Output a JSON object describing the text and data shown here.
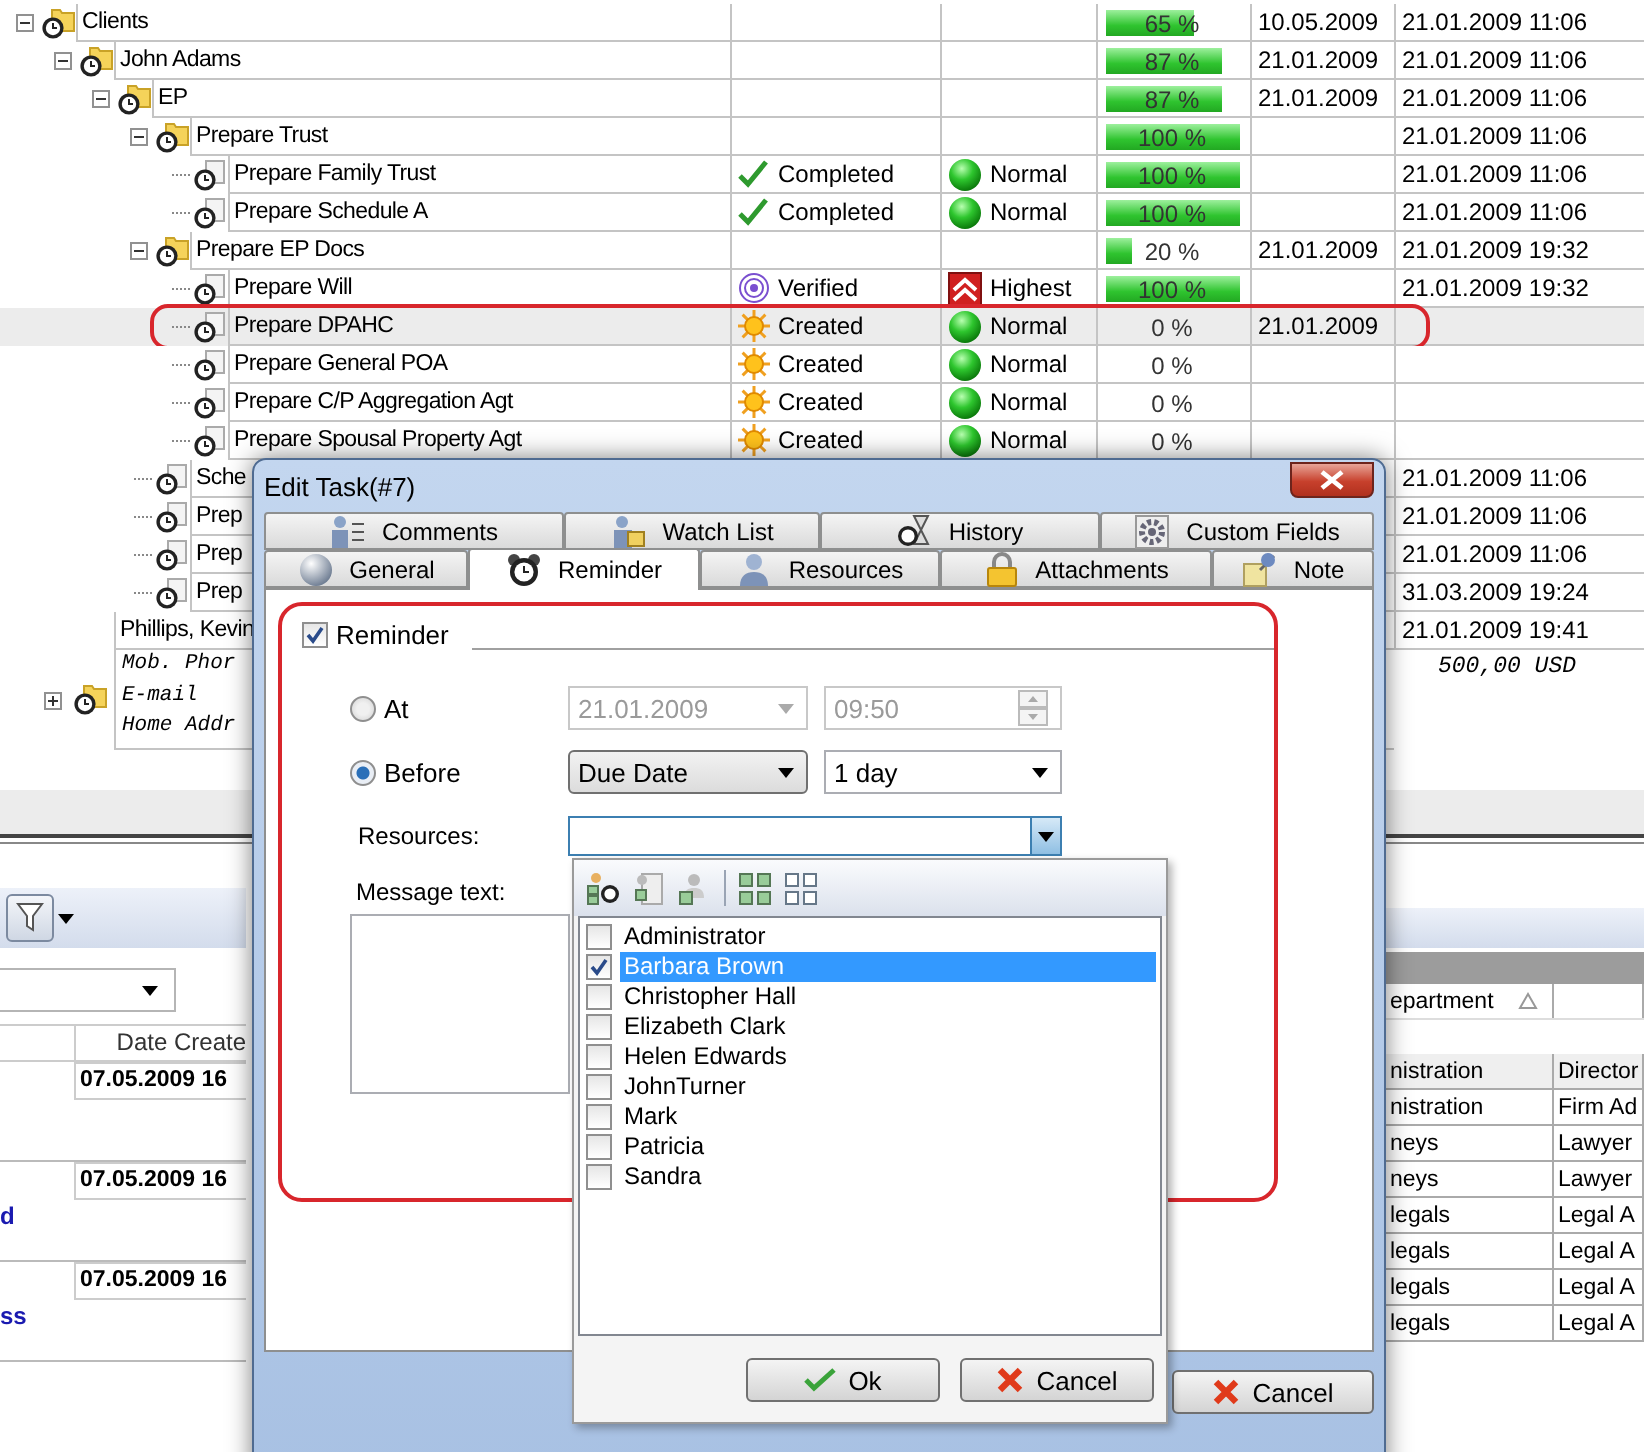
{
  "tree": [
    {
      "kind": "task",
      "name": "Clients",
      "expanded": true,
      "selected": false,
      "progress": {
        "level": 0.65,
        "text": "65 %"
      },
      "due": "10.05.2009",
      "created": "21.01.2009 11:06",
      "children": [
        {
          "kind": "task",
          "name": "John Adams",
          "expanded": true,
          "selected": false,
          "progress": {
            "level": 0.87,
            "text": "87 %"
          },
          "due": "21.01.2009",
          "created": "21.01.2009 11:06",
          "children": [
            {
              "kind": "task",
              "name": "EP",
              "expanded": true,
              "selected": false,
              "progress": {
                "level": 0.87,
                "text": "87 %"
              },
              "due": "21.01.2009",
              "created": "21.01.2009 11:06",
              "children": [
                {
                  "kind": "task",
                  "name": "Prepare Trust",
                  "expanded": true,
                  "selected": false,
                  "progress": {
                    "level": 1,
                    "text": "100 %"
                  },
                  "created": "21.01.2009 11:06",
                  "children": [
                    {
                      "kind": "task",
                      "name": "Prepare Family Trust",
                      "selected": false,
                      "status": {
                        "kind": "completed",
                        "text": "Completed"
                      },
                      "priority": {
                        "kind": "normal",
                        "text": "Normal"
                      },
                      "progress": {
                        "level": 1,
                        "text": "100 %"
                      },
                      "created": "21.01.2009 11:06"
                    },
                    {
                      "kind": "task",
                      "name": "Prepare Schedule A",
                      "selected": false,
                      "status": {
                        "kind": "completed",
                        "text": "Completed"
                      },
                      "priority": {
                        "kind": "normal",
                        "text": "Normal"
                      },
                      "progress": {
                        "level": 1,
                        "text": "100 %"
                      },
                      "created": "21.01.2009 11:06"
                    }
                  ]
                },
                {
                  "kind": "task",
                  "name": "Prepare EP Docs",
                  "expanded": true,
                  "selected": false,
                  "progress": {
                    "level": 0.2,
                    "text": "20 %"
                  },
                  "due": "21.01.2009",
                  "created": "21.01.2009 19:32",
                  "children": [
                    {
                      "kind": "task",
                      "name": "Prepare Will",
                      "selected": false,
                      "status": {
                        "kind": "verified",
                        "text": "Verified"
                      },
                      "priority": {
                        "kind": "highest",
                        "text": "Highest"
                      },
                      "progress": {
                        "level": 1,
                        "text": "100 %"
                      },
                      "created": "21.01.2009 19:32"
                    },
                    {
                      "kind": "task",
                      "name": "Prepare DPAHC",
                      "selected": true,
                      "status": {
                        "kind": "created",
                        "text": "Created"
                      },
                      "priority": {
                        "kind": "normal",
                        "text": "Normal"
                      },
                      "progress": {
                        "level": 0,
                        "text": "0 %"
                      },
                      "due": "21.01.2009"
                    },
                    {
                      "kind": "task",
                      "name": "Prepare General POA",
                      "selected": false,
                      "status": {
                        "kind": "created",
                        "text": "Created"
                      },
                      "priority": {
                        "kind": "normal",
                        "text": "Normal"
                      },
                      "progress": {
                        "level": 0,
                        "text": "0 %"
                      }
                    },
                    {
                      "kind": "task",
                      "name": "Prepare C/P Aggregation Agt",
                      "selected": false,
                      "status": {
                        "kind": "created",
                        "text": "Created"
                      },
                      "priority": {
                        "kind": "normal",
                        "text": "Normal"
                      },
                      "progress": {
                        "level": 0,
                        "text": "0 %"
                      }
                    },
                    {
                      "kind": "task",
                      "name": "Prepare Spousal Property Agt",
                      "selected": false,
                      "status": {
                        "kind": "created",
                        "text": "Created"
                      },
                      "priority": {
                        "kind": "normal",
                        "text": "Normal"
                      },
                      "progress": {
                        "level": 0,
                        "text": "0 %"
                      }
                    }
                  ]
                },
                {
                  "kind": "task",
                  "name": "Sche",
                  "selected": false,
                  "created": "21.01.2009 11:06"
                },
                {
                  "kind": "task",
                  "name": "Prep",
                  "selected": false,
                  "created": "21.01.2009 11:06"
                },
                {
                  "kind": "task",
                  "name": "Prep",
                  "selected": false,
                  "created": "21.01.2009 11:06"
                },
                {
                  "kind": "task",
                  "name": "Prep",
                  "selected": false,
                  "created": "31.03.2009 19:24"
                }
              ]
            }
          ]
        },
        {
          "kind": "card",
          "name": "Phillips, Kevin",
          "expanded": false,
          "selected": false,
          "created": "21.01.2009 19:41",
          "lines": [
            "Mob. Phor",
            "E-mail",
            "Home Addr"
          ],
          "amount": "500,00 USD"
        }
      ]
    }
  ],
  "lower_left": {
    "header": "Date Create",
    "groups": [
      {
        "date": "07.05.2009 16"
      },
      {
        "date": "07.05.2009 16",
        "note": "d"
      },
      {
        "date": "07.05.2009 16",
        "note": "ss"
      }
    ]
  },
  "lower_right": {
    "header": "epartment",
    "rows": [
      [
        "nistration",
        "Director"
      ],
      [
        "nistration",
        "Firm Ad"
      ],
      [
        "neys",
        "Lawyer"
      ],
      [
        "neys",
        "Lawyer"
      ],
      [
        "legals",
        "Legal A"
      ],
      [
        "legals",
        "Legal A"
      ],
      [
        "legals",
        "Legal A"
      ],
      [
        "legals",
        "Legal A"
      ]
    ]
  },
  "dialog": {
    "title": "Edit Task(#7)",
    "tab_rows": [
      [
        {
          "label": "Comments",
          "selected": false
        },
        {
          "label": "Watch List",
          "selected": false
        },
        {
          "label": "History",
          "selected": false
        },
        {
          "label": "Custom Fields",
          "selected": false
        }
      ],
      [
        {
          "label": "General",
          "selected": false
        },
        {
          "label": "Reminder",
          "selected": true
        },
        {
          "label": "Resources",
          "selected": false
        },
        {
          "label": "Attachments",
          "selected": false
        },
        {
          "label": "Note",
          "selected": false
        }
      ]
    ],
    "reminder": {
      "label": "Reminder",
      "checked": true,
      "options": [
        {
          "label": "At",
          "selected": false,
          "disabled": true,
          "fields": [
            {
              "kind": "date",
              "value": "21.01.2009"
            },
            {
              "kind": "time",
              "value": "09:50"
            }
          ]
        },
        {
          "label": "Before",
          "selected": true,
          "disabled": false,
          "fields": [
            {
              "kind": "combo",
              "value": "Due Date"
            },
            {
              "kind": "select",
              "value": "1 day"
            }
          ]
        }
      ],
      "resources_label": "Resources:",
      "message_label": "Message text:"
    },
    "resource_popup": {
      "items": [
        {
          "name": "Administrator",
          "checked": false,
          "selected": false
        },
        {
          "name": "Barbara Brown",
          "checked": true,
          "selected": true
        },
        {
          "name": "Christopher Hall",
          "checked": false,
          "selected": false
        },
        {
          "name": "Elizabeth Clark",
          "checked": false,
          "selected": false
        },
        {
          "name": "Helen Edwards",
          "checked": false,
          "selected": false
        },
        {
          "name": "JohnTurner",
          "checked": false,
          "selected": false
        },
        {
          "name": "Mark",
          "checked": false,
          "selected": false
        },
        {
          "name": "Patricia",
          "checked": false,
          "selected": false
        },
        {
          "name": "Sandra",
          "checked": false,
          "selected": false
        }
      ],
      "buttons": [
        {
          "kind": "ok",
          "label": "Ok"
        },
        {
          "kind": "cancel",
          "label": "Cancel"
        }
      ]
    },
    "buttons": [
      {
        "kind": "cancel",
        "label": "Cancel"
      }
    ]
  }
}
